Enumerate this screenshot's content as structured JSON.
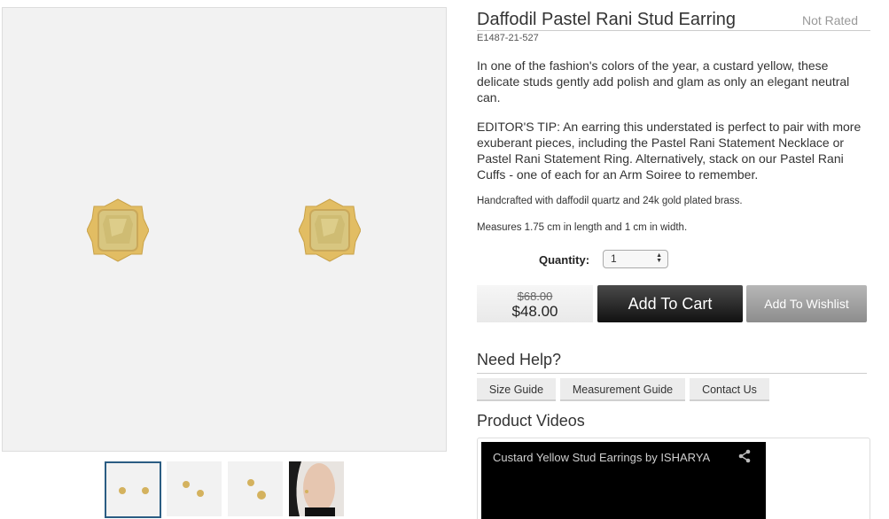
{
  "product": {
    "title": "Daffodil Pastel Rani Stud Earring",
    "rating": "Not Rated",
    "sku": "E1487-21-527",
    "description_1": "In one of the fashion's colors of the year, a custard yellow, these delicate studs gently add polish and glam as only an elegant neutral can.",
    "description_2": "EDITOR'S TIP: An earring this understated is perfect to pair with more exuberant pieces, including the Pastel Rani Statement Necklace or Pastel Rani Statement Ring. Alternatively, stack on our Pastel Rani Cuffs - one of each for an Arm Soiree to remember.",
    "materials": "Handcrafted with daffodil quartz and 24k gold plated brass.",
    "measurements": "Measures 1.75 cm in length and 1 cm in width."
  },
  "purchase": {
    "quantity_label": "Quantity:",
    "quantity_value": "1",
    "old_price": "$68.00",
    "new_price": "$48.00",
    "add_to_cart": "Add To Cart",
    "add_to_wishlist": "Add To Wishlist"
  },
  "help": {
    "heading": "Need Help?",
    "buttons": [
      "Size Guide",
      "Measurement Guide",
      "Contact Us"
    ]
  },
  "videos": {
    "heading": "Product Videos",
    "video_title": "Custard Yellow Stud Earrings by ISHARYA"
  },
  "colors": {
    "gold": "#d9b25c",
    "stone": "#d6c27a",
    "thumb_border": "#2b5d83"
  }
}
